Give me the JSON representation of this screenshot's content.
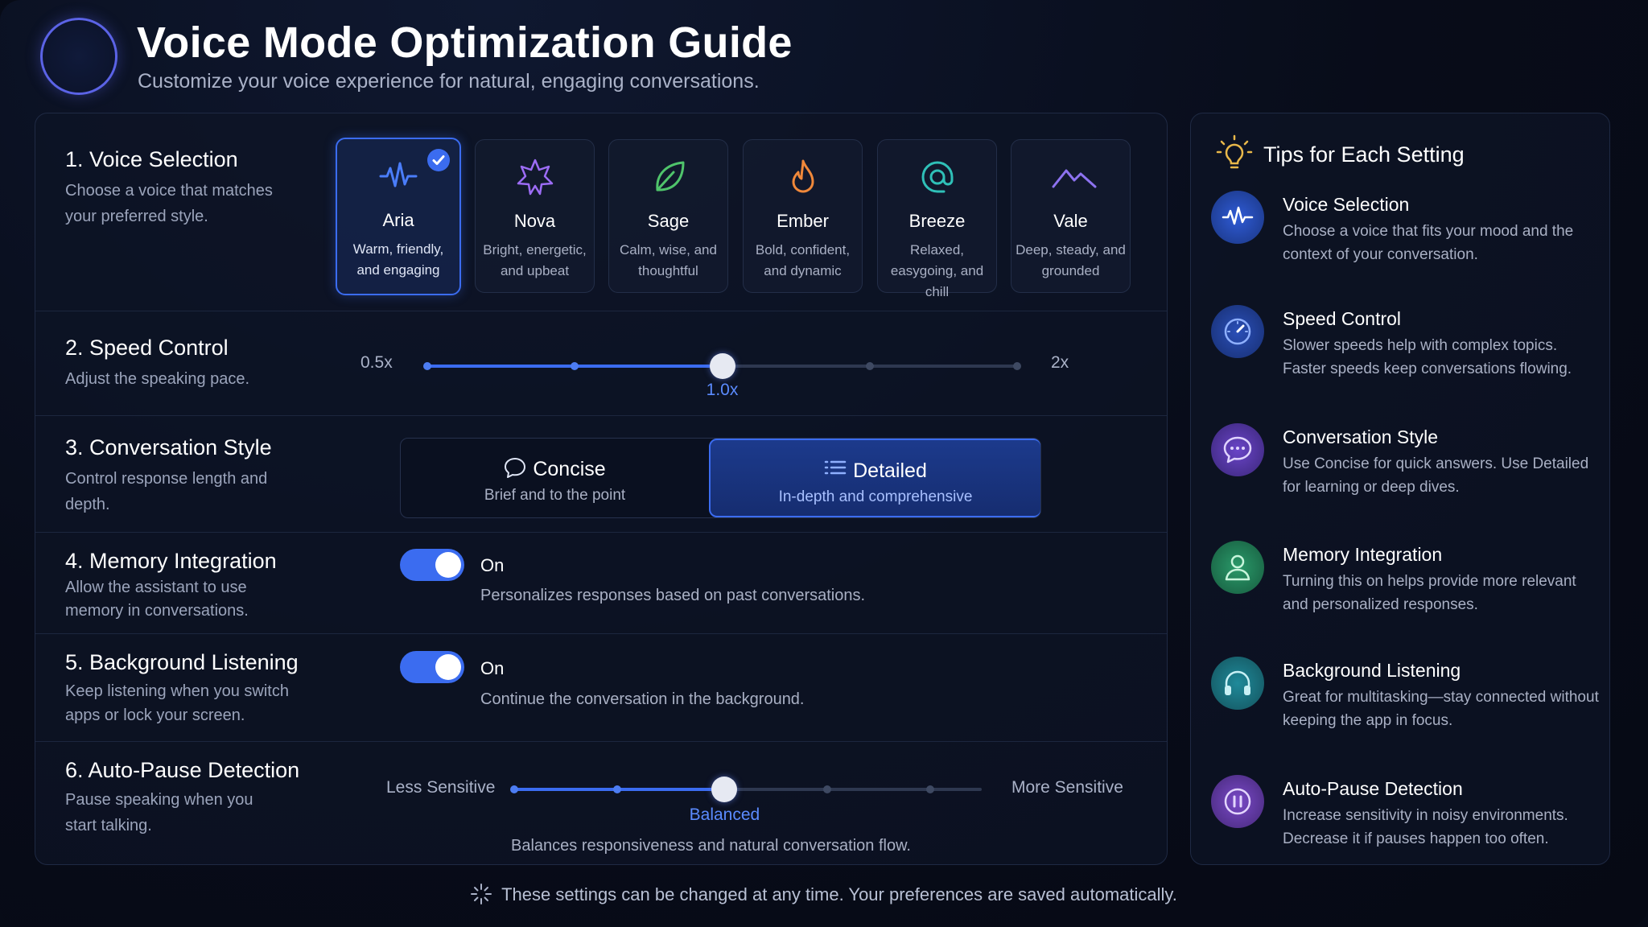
{
  "header": {
    "title": "Voice Mode Optimization Guide",
    "subtitle": "Customize your voice experience for natural, engaging conversations."
  },
  "sections": {
    "voice": {
      "title": "1. Voice Selection",
      "desc": "Choose a voice that matches your preferred style.",
      "selected": "Aria",
      "voices": [
        {
          "name": "Aria",
          "desc": "Warm, friendly, and engaging",
          "icon": "waveform-icon",
          "color": "#4a7dfa"
        },
        {
          "name": "Nova",
          "desc": "Bright, energetic, and upbeat",
          "icon": "sparkle-star-icon",
          "color": "#9c6cf5"
        },
        {
          "name": "Sage",
          "desc": "Calm, wise, and thoughtful",
          "icon": "leaf-icon",
          "color": "#4fc46b"
        },
        {
          "name": "Ember",
          "desc": "Bold, confident, and dynamic",
          "icon": "flame-icon",
          "color": "#f0883a"
        },
        {
          "name": "Breeze",
          "desc": "Relaxed, easygoing, and chill",
          "icon": "swirl-icon",
          "color": "#2fc0b8"
        },
        {
          "name": "Vale",
          "desc": "Deep, steady, and grounded",
          "icon": "mountains-icon",
          "color": "#8d72f0"
        }
      ]
    },
    "speed": {
      "title": "2. Speed Control",
      "desc": "Adjust the speaking pace.",
      "min_label": "0.5x",
      "max_label": "2x",
      "value_label": "1.0x",
      "value": 1.0,
      "min": 0.5,
      "max": 2.0,
      "stops": [
        0.5,
        0.75,
        1.0,
        1.5,
        2.0
      ]
    },
    "style": {
      "title": "3. Conversation Style",
      "desc": "Control response length and depth.",
      "selected": "Detailed",
      "options": [
        {
          "label": "Concise",
          "desc": "Brief and to the point"
        },
        {
          "label": "Detailed",
          "desc": "In-depth and comprehensive"
        }
      ]
    },
    "memory": {
      "title": "4. Memory Integration",
      "desc": "Allow the assistant to use memory in conversations.",
      "state": "On",
      "note": "Personalizes responses based on past conversations."
    },
    "background": {
      "title": "5. Background Listening",
      "desc": "Keep listening when you switch apps or lock your screen.",
      "state": "On",
      "note": "Continue the conversation in the background."
    },
    "autopause": {
      "title": "6. Auto-Pause Detection",
      "desc": "Pause speaking when you start talking.",
      "min_label": "Less Sensitive",
      "max_label": "More Sensitive",
      "value_label": "Balanced",
      "note": "Balances responsiveness and natural conversation flow.",
      "level": 0.45,
      "stops": [
        0.0,
        0.22,
        0.45,
        0.67,
        0.89
      ]
    }
  },
  "tips": {
    "header": "Tips for Each Setting",
    "items": [
      {
        "title": "Voice Selection",
        "desc": "Choose a voice that fits your mood and the context of your conversation.",
        "icon": "waveform-icon",
        "color": "#2f5bd6"
      },
      {
        "title": "Speed Control",
        "desc": "Slower speeds help with complex topics. Faster speeds keep conversations flowing.",
        "icon": "speedometer-icon",
        "color": "#2f5bd6"
      },
      {
        "title": "Conversation Style",
        "desc": "Use Concise for quick answers. Use Detailed for learning or deep dives.",
        "icon": "chat-bubble-icon",
        "color": "#6a45c8"
      },
      {
        "title": "Memory Integration",
        "desc": "Turning this on helps provide more relevant and personalized responses.",
        "icon": "user-icon",
        "color": "#2a9a6a"
      },
      {
        "title": "Background Listening",
        "desc": "Great for multitasking—stay connected without keeping the app in focus.",
        "icon": "headphones-icon",
        "color": "#1f8a9a"
      },
      {
        "title": "Auto-Pause Detection",
        "desc": "Increase sensitivity in noisy environments. Decrease it if pauses happen too often.",
        "icon": "pause-icon",
        "color": "#7a4ac8"
      }
    ]
  },
  "footer": {
    "text": "These settings can be changed at any time. Your preferences are saved automatically."
  },
  "colors": {
    "accent": "#3b6cf0",
    "background": "#070b17",
    "panel_border": "#1f2a44"
  }
}
